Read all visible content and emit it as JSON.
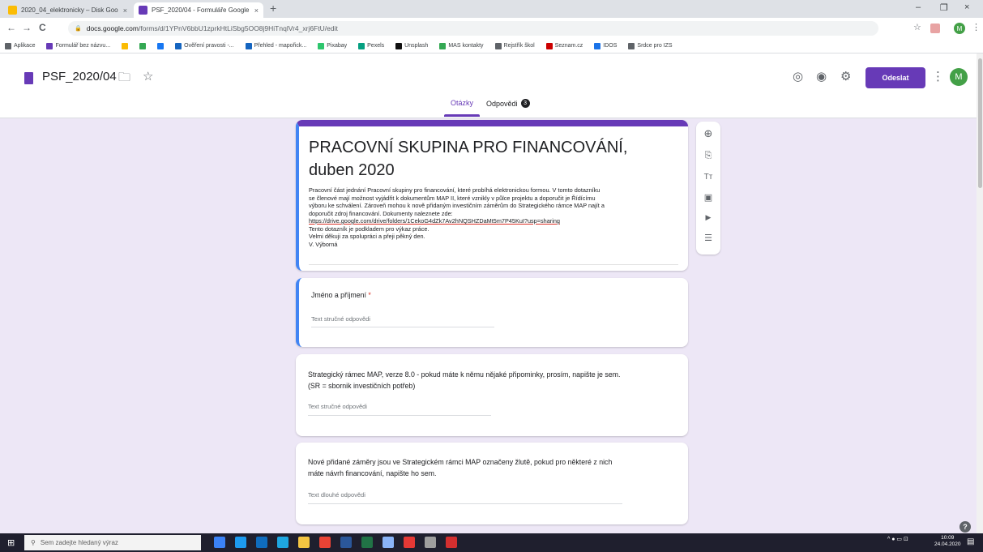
{
  "browser": {
    "tabs": [
      {
        "label": "2020_04_elektronicky – Disk Goo",
        "close": "×",
        "favicon_color": "#fbbc04"
      },
      {
        "label": "PSF_2020/04 - Formuláře Google",
        "close": "×",
        "favicon_color": "#673ab7"
      }
    ],
    "new_tab": "+",
    "window_controls": {
      "minimize": "–",
      "maximize": "❐",
      "close": "×"
    },
    "nav": {
      "back": "←",
      "forward": "→",
      "reload": "C",
      "lock": "🔒"
    },
    "url_host": "docs.google.com",
    "url_path": "/forms/d/1YPnV6bbU1zprkHtLiSbg5OO8j9HiTnqlVr4_xrj6FtU/edit",
    "star": "☆",
    "menu": "⋮",
    "profile_initial": "M"
  },
  "bookmarks": [
    {
      "label": "Aplikace",
      "color": "#5f6368"
    },
    {
      "label": "Formulář bez názvu...",
      "color": "#673ab7"
    },
    {
      "label": "",
      "color": "#fbbc04"
    },
    {
      "label": "",
      "color": "#34a853"
    },
    {
      "label": "",
      "color": "#1877f2"
    },
    {
      "label": "Ověření pravosti -...",
      "color": "#1565c0"
    },
    {
      "label": "Přehled - mapořick...",
      "color": "#1565c0"
    },
    {
      "label": "Pixabay",
      "color": "#2ec66d"
    },
    {
      "label": "Pexels",
      "color": "#05a081"
    },
    {
      "label": "Unsplash",
      "color": "#111111"
    },
    {
      "label": "MAS kontakty",
      "color": "#34a853"
    },
    {
      "label": "Rejstřík škol",
      "color": "#5f6368"
    },
    {
      "label": "Seznam.cz",
      "color": "#cc0000"
    },
    {
      "label": "IDOS",
      "color": "#1a73e8"
    },
    {
      "label": "Srdce pro IZS",
      "color": "#5f6368"
    }
  ],
  "header": {
    "doc_name": "PSF_2020/04",
    "folder_icon": "🗀",
    "star_icon": "☆",
    "palette_icon": "◎",
    "preview_icon": "◉",
    "settings_icon": "⚙",
    "send_label": "Odeslat",
    "more_icon": "⋮",
    "avatar_initial": "M",
    "tab_questions": "Otázky",
    "tab_responses": "Odpovědi",
    "responses_count": "3"
  },
  "form": {
    "title": "PRACOVNÍ SKUPINA PRO FINANCOVÁNÍ, duben 2020",
    "description_lines": [
      "Pracovní část jednání Pracovní skupiny pro financování, které probíhá elektronickou formou. V tomto dotazníku",
      "se členové mají možnost vyjádřit k dokumentům MAP II, které vznikly v půlce projektu a doporučit je Řídícímu",
      "výboru ke schválení. Zároveň mohou k nově přidaným investičním záměrům do Strategického rámce MAP najít a",
      "doporučit zdroj financování. Dokumenty naleznete zde:",
      "https://drive.google.com/drive/folders/1CekoG4dZk7Av2hNQSHZDaMt5m7P45KuI?usp=sharing",
      "Tento dotazník je podkladem pro výkaz práce.",
      "Velmi děkuji za spolupráci a přeji pěkný den.",
      "V. Výborná"
    ],
    "questions": [
      {
        "title": "Jméno a příjmení",
        "required_mark": "*",
        "placeholder": "Text stručné odpovědi"
      },
      {
        "title_lines": [
          "Strategický rámec MAP, verze 8.0 - pokud máte k němu nějaké připominky, prosím, napište je sem.",
          "(SR = sbornik investičních potřeb)"
        ],
        "placeholder": "Text stručné odpovědi"
      },
      {
        "title_lines": [
          "Nové přidané záměry jsou ve Strategickém rámci MAP označeny žlutě, pokud pro některé z nich",
          "máte návrh financování, napište ho sem."
        ],
        "placeholder": "Text dlouhé odpovědi"
      }
    ]
  },
  "side_tools": {
    "add_question": "⊕",
    "import_questions": "⎘",
    "add_title": "Tт",
    "add_image": "▣",
    "add_video": "▶",
    "add_section": "☰"
  },
  "help_icon": "?",
  "taskbar": {
    "start_icon": "⊞",
    "search_icon": "⚲",
    "search_placeholder": "Sem zadejte hledaný výraz",
    "apps": [
      {
        "name": "task-view",
        "color": "#3b82f6"
      },
      {
        "name": "edge",
        "color": "#1d9bf0"
      },
      {
        "name": "outlook",
        "color": "#0f6cbd"
      },
      {
        "name": "ie",
        "color": "#1ea7e1"
      },
      {
        "name": "explorer",
        "color": "#f4c542"
      },
      {
        "name": "chrome",
        "color": "#ea4335"
      },
      {
        "name": "word",
        "color": "#2b579a"
      },
      {
        "name": "excel",
        "color": "#217346"
      },
      {
        "name": "paint",
        "color": "#8ab4f8"
      },
      {
        "name": "app-red",
        "color": "#e53935"
      },
      {
        "name": "calculator",
        "color": "#9e9e9e"
      },
      {
        "name": "acrobat",
        "color": "#d32f2f"
      }
    ],
    "tray": "^ ● ▭ ⊡",
    "time": "10:09",
    "date": "24.04.2020",
    "notifications_icon": "▤"
  }
}
